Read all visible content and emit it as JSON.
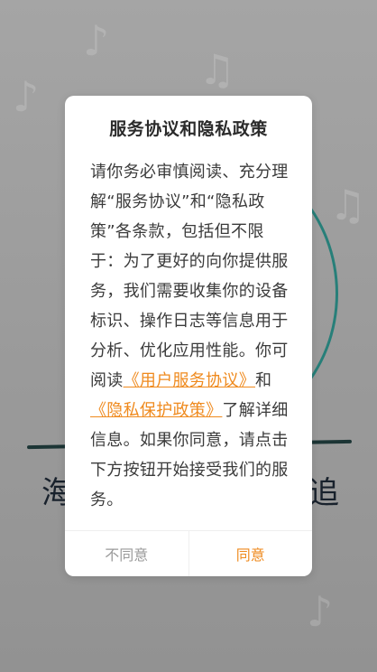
{
  "background": {
    "title_left": "海",
    "title_right": "追",
    "note_glyph": "♪",
    "note_glyph2": "♫"
  },
  "dialog": {
    "title": "服务协议和隐私政策",
    "body_text_1": "请你务必审慎阅读、充分理解“服务协议”和“隐私政策”各条款，包括但不限于：为了更好的向你提供服务，我们需要收集你的设备标识、操作日志等信息用于分析、优化应用性能。你可阅读",
    "link_user_agreement": "《用户服务协议》",
    "body_text_and": "和",
    "link_privacy_policy": "《隐私保护政策》",
    "body_text_2": "了解详细信息。如果你同意，请点击下方按钮开始接受我们的服务。",
    "disagree_label": "不同意",
    "agree_label": "同意"
  },
  "colors": {
    "accent": "#ef8a1e",
    "ring": "#2b8a84"
  }
}
